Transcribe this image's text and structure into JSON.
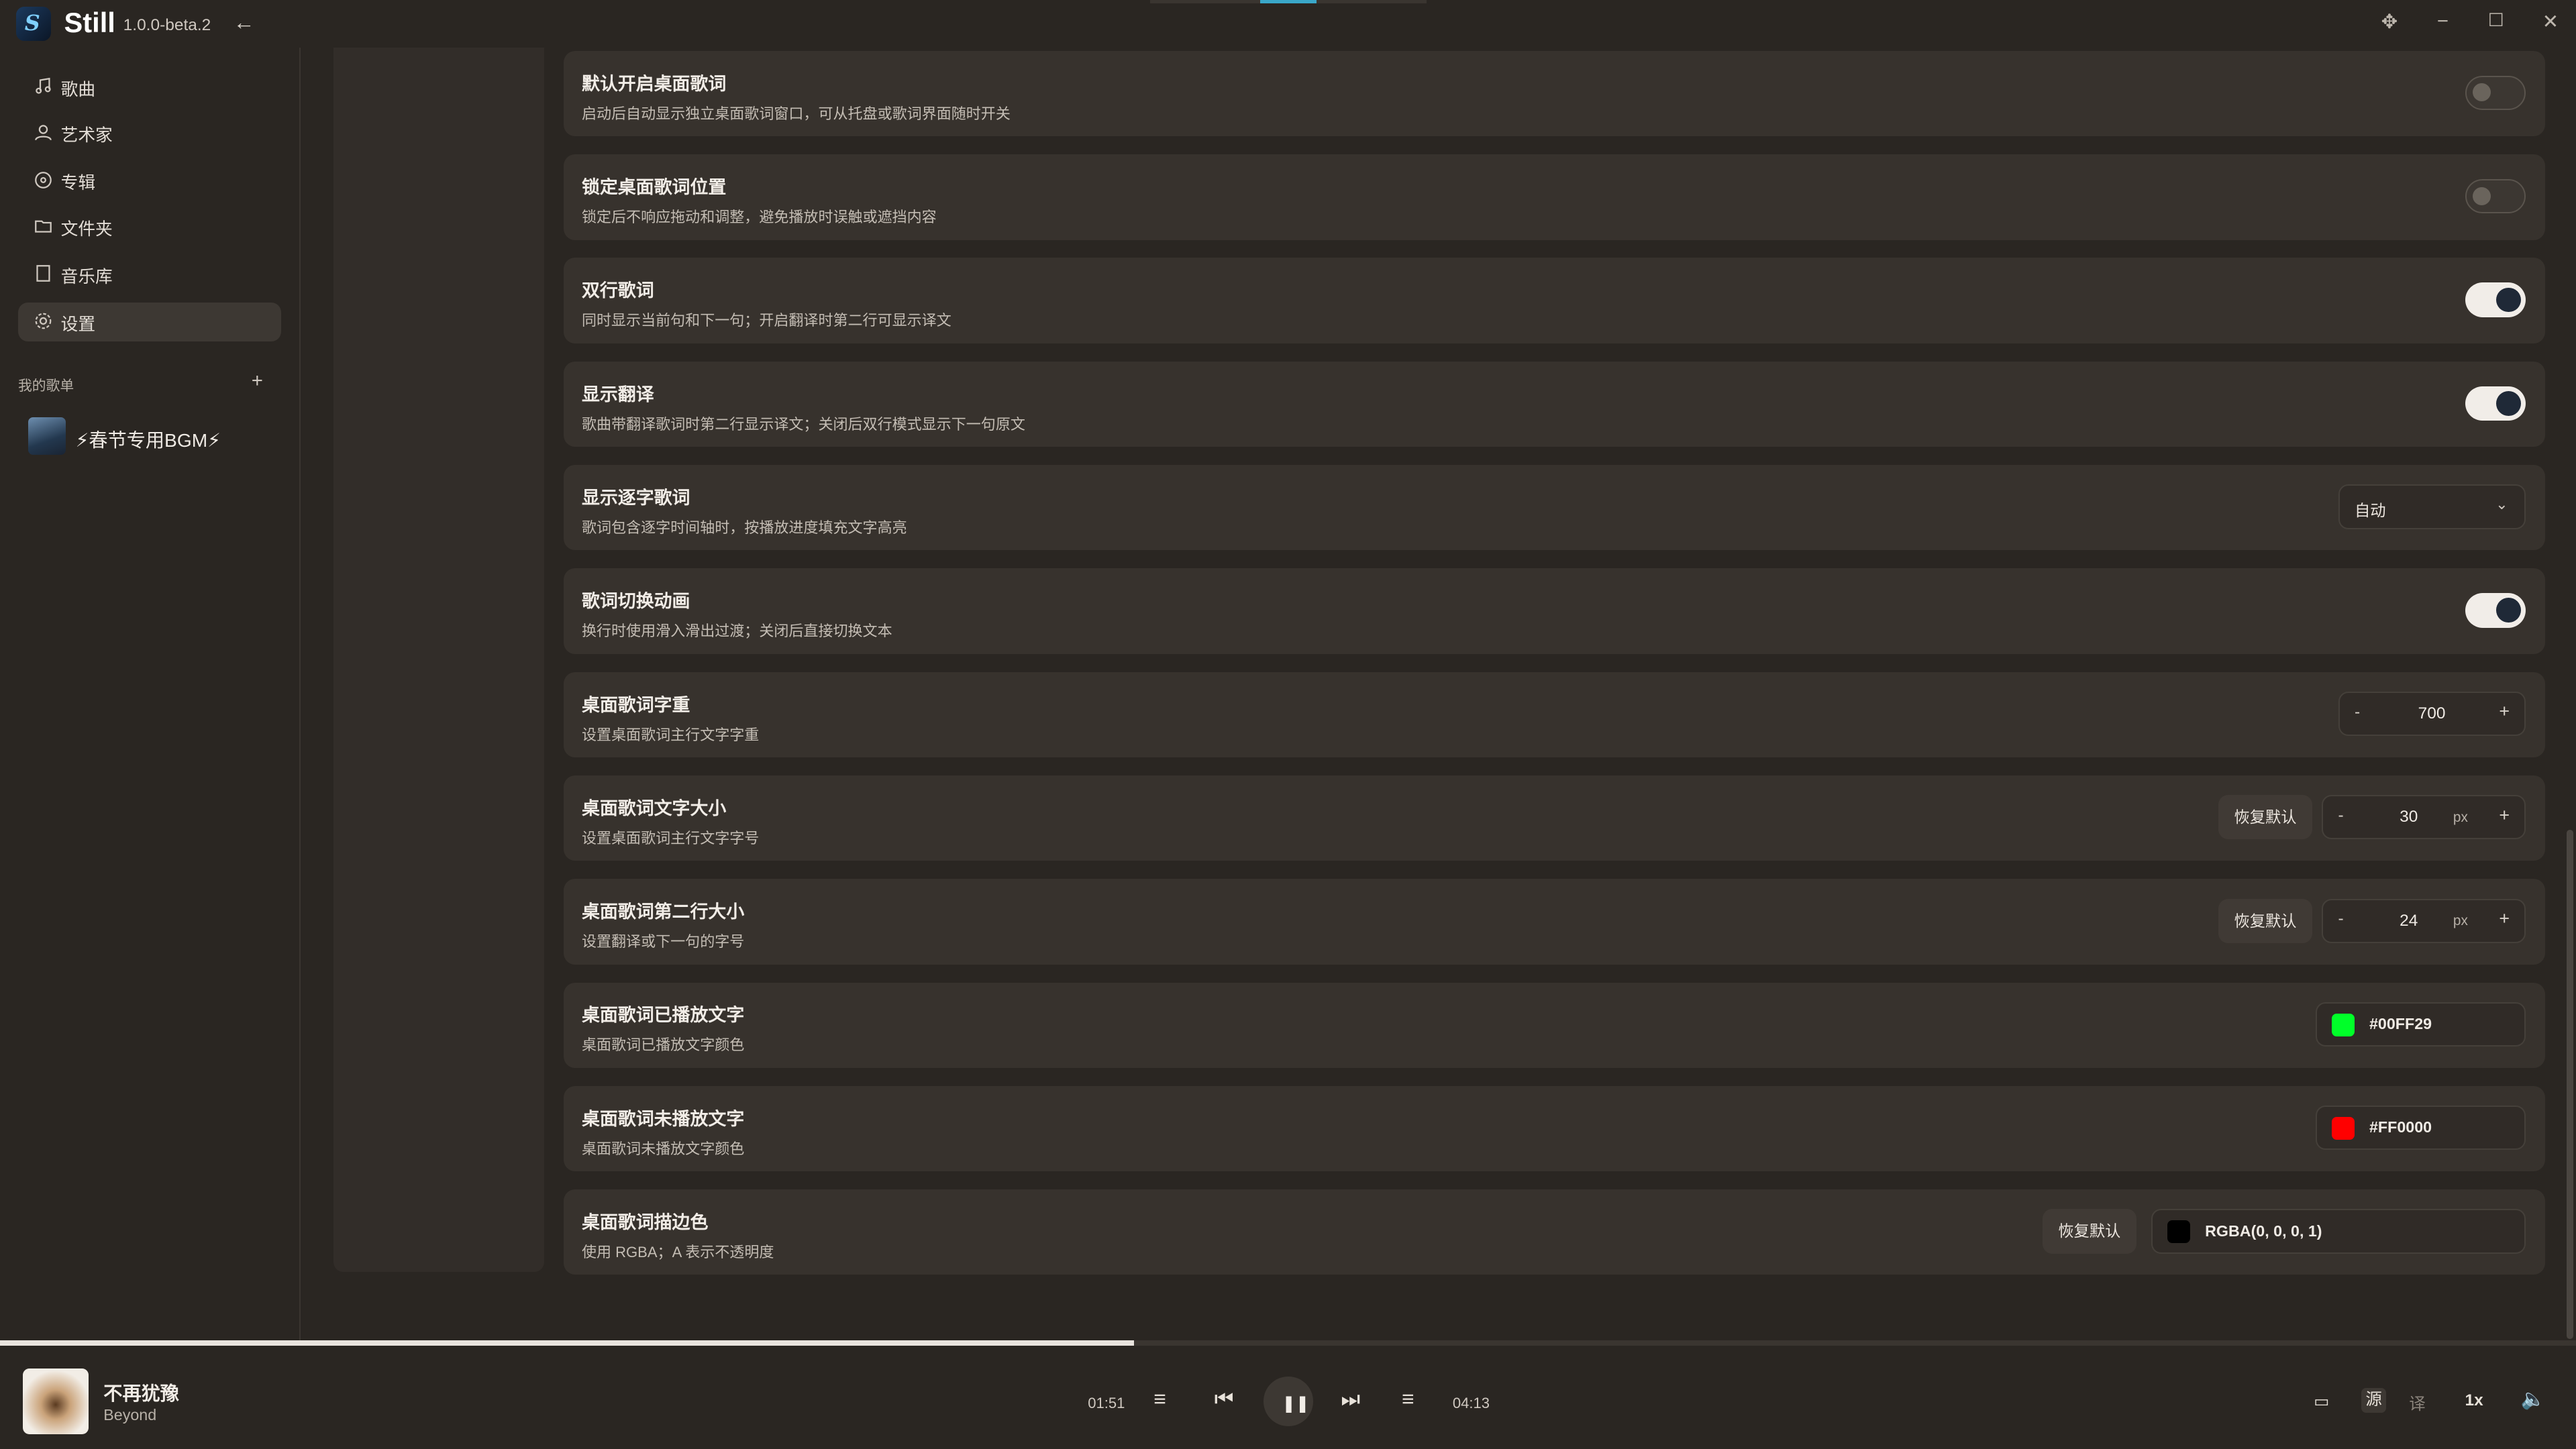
{
  "app": {
    "name": "Still",
    "version": "1.0.0-beta.2"
  },
  "sidebar": {
    "items": [
      {
        "label": "歌曲",
        "icon": "music-note-icon"
      },
      {
        "label": "艺术家",
        "icon": "user-icon"
      },
      {
        "label": "专辑",
        "icon": "disc-icon"
      },
      {
        "label": "文件夹",
        "icon": "folder-icon"
      },
      {
        "label": "音乐库",
        "icon": "library-icon"
      },
      {
        "label": "设置",
        "icon": "gear-icon",
        "active": true
      }
    ],
    "playlists_title": "我的歌单",
    "playlists": [
      {
        "name": "⚡春节专用BGM⚡"
      }
    ]
  },
  "settings": {
    "rows": [
      {
        "title": "默认开启桌面歌词",
        "desc": "启动后自动显示独立桌面歌词窗口，可从托盘或歌词界面随时开关",
        "control": "toggle",
        "on": false
      },
      {
        "title": "锁定桌面歌词位置",
        "desc": "锁定后不响应拖动和调整，避免播放时误触或遮挡内容",
        "control": "toggle",
        "on": false
      },
      {
        "title": "双行歌词",
        "desc": "同时显示当前句和下一句；开启翻译时第二行可显示译文",
        "control": "toggle",
        "on": true
      },
      {
        "title": "显示翻译",
        "desc": "歌曲带翻译歌词时第二行显示译文；关闭后双行模式显示下一句原文",
        "control": "toggle",
        "on": true
      },
      {
        "title": "显示逐字歌词",
        "desc": "歌词包含逐字时间轴时，按播放进度填充文字高亮",
        "control": "select",
        "value": "自动"
      },
      {
        "title": "歌词切换动画",
        "desc": "换行时使用滑入滑出过渡；关闭后直接切换文本",
        "control": "toggle",
        "on": true
      },
      {
        "title": "桌面歌词字重",
        "desc": "设置桌面歌词主行文字字重",
        "control": "stepper",
        "value": "700"
      },
      {
        "title": "桌面歌词文字大小",
        "desc": "设置桌面歌词主行文字字号",
        "control": "stepper",
        "value": "30",
        "unit": "px",
        "reset": "恢复默认"
      },
      {
        "title": "桌面歌词第二行大小",
        "desc": "设置翻译或下一句的字号",
        "control": "stepper",
        "value": "24",
        "unit": "px",
        "reset": "恢复默认"
      },
      {
        "title": "桌面歌词已播放文字",
        "desc": "桌面歌词已播放文字颜色",
        "control": "color",
        "value": "#00FF29",
        "swatch": "#00FF29"
      },
      {
        "title": "桌面歌词未播放文字",
        "desc": "桌面歌词未播放文字颜色",
        "control": "color",
        "value": "#FF0000",
        "swatch": "#FF0000"
      },
      {
        "title": "桌面歌词描边色",
        "desc": "使用 RGBA；A 表示不透明度",
        "control": "color",
        "value": "RGBA(0, 0, 0, 1)",
        "swatch": "#000000",
        "reset": "恢复默认"
      }
    ],
    "stepper_minus": "-",
    "stepper_plus": "+"
  },
  "player": {
    "song": "不再犹豫",
    "artist": "Beyond",
    "current": "01:51",
    "total": "04:13",
    "progress": 0.44,
    "source_label": "源",
    "translate_label": "译",
    "speed": "1x"
  }
}
